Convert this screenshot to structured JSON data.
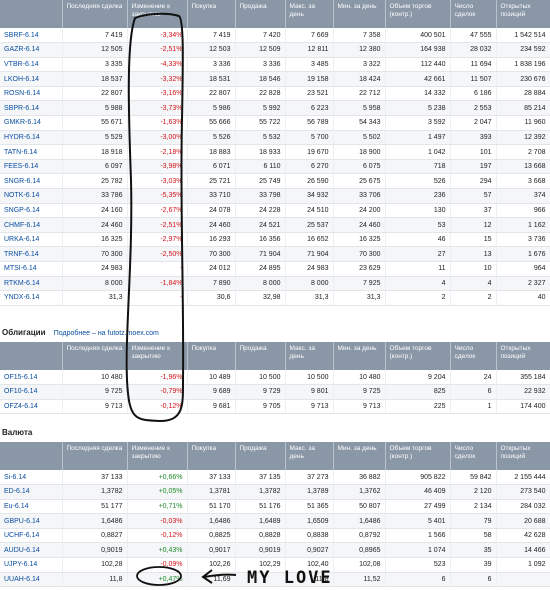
{
  "headers": {
    "futures": [
      "",
      "Последняя сделка",
      "Изменение к закрытию",
      "Покупка",
      "Продажа",
      "Макс. за день",
      "Мин. за день",
      "Объем торгов (контр.)",
      "Число сделок",
      "Открытых позиций"
    ],
    "bonds": [
      "",
      "Последняя сделка",
      "Изменение к закрытию",
      "Покупка",
      "Продажа",
      "Макс. за день",
      "Мин. за день",
      "Объем торгов (контр.)",
      "Число сделок",
      "Открытых позиций"
    ],
    "currency": [
      "",
      "Последняя сделка",
      "Изменение к закрытию",
      "Покупка",
      "Продажа",
      "Макс. за день",
      "Мин. за день",
      "Объем торгов (контр.)",
      "Число сделок",
      "Открытых позиций"
    ]
  },
  "futures": [
    [
      "SBRF-6.14",
      "7 419",
      "-3,34%",
      "7 419",
      "7 420",
      "7 669",
      "7 358",
      "400 501",
      "47 555",
      "1 542 514",
      "neg"
    ],
    [
      "GAZR-6.14",
      "12 505",
      "-2,51%",
      "12 503",
      "12 509",
      "12 811",
      "12 380",
      "164 938",
      "28 032",
      "234 592",
      "neg"
    ],
    [
      "VTBR-6.14",
      "3 335",
      "-4,33%",
      "3 336",
      "3 336",
      "3 485",
      "3 322",
      "112 440",
      "11 694",
      "1 838 196",
      "neg"
    ],
    [
      "LKOH-6.14",
      "18 537",
      "-3,32%",
      "18 531",
      "18 546",
      "19 158",
      "18 424",
      "42 661",
      "11 507",
      "230 676",
      "neg"
    ],
    [
      "ROSN-6.14",
      "22 807",
      "-3,16%",
      "22 807",
      "22 828",
      "23 521",
      "22 712",
      "14 332",
      "6 186",
      "28 884",
      "neg"
    ],
    [
      "SBPR-6.14",
      "5 988",
      "-3,73%",
      "5 986",
      "5 992",
      "6 223",
      "5 958",
      "5 238",
      "2 553",
      "85 214",
      "neg"
    ],
    [
      "GMKR-6.14",
      "55 671",
      "-1,63%",
      "55 666",
      "55 722",
      "56 789",
      "54 343",
      "3 592",
      "2 047",
      "11 960",
      "neg"
    ],
    [
      "HYDR-6.14",
      "5 529",
      "-3,00%",
      "5 526",
      "5 532",
      "5 700",
      "5 502",
      "1 497",
      "393",
      "12 392",
      "neg"
    ],
    [
      "TATN-6.14",
      "18 918",
      "-2,18%",
      "18 883",
      "18 933",
      "19 670",
      "18 900",
      "1 042",
      "101",
      "2 708",
      "neg"
    ],
    [
      "FEES-6.14",
      "6 097",
      "-3,98%",
      "6 071",
      "6 110",
      "6 270",
      "6 075",
      "718",
      "197",
      "13 668",
      "neg"
    ],
    [
      "SNGR-6.14",
      "25 782",
      "-3,03%",
      "25 721",
      "25 749",
      "26 590",
      "25 675",
      "526",
      "294",
      "3 668",
      "neg"
    ],
    [
      "NOTK-6.14",
      "33 786",
      "-5,35%",
      "33 710",
      "33 798",
      "34 932",
      "33 706",
      "236",
      "57",
      "374",
      "neg"
    ],
    [
      "SNGP-6.14",
      "24 160",
      "-2,67%",
      "24 078",
      "24 228",
      "24 510",
      "24 200",
      "130",
      "37",
      "966",
      "neg"
    ],
    [
      "CHMF-6.14",
      "24 460",
      "-2,51%",
      "24 460",
      "24 521",
      "25 537",
      "24 460",
      "53",
      "12",
      "1 162",
      "neg"
    ],
    [
      "URKA-6.14",
      "16 325",
      "-2,97%",
      "16 293",
      "16 356",
      "16 652",
      "16 325",
      "46",
      "15",
      "3 736",
      "neg"
    ],
    [
      "TRNF-6.14",
      "70 300",
      "-2,50%",
      "70 300",
      "71 904",
      "71 904",
      "70 300",
      "27",
      "13",
      "1 676",
      "neg"
    ],
    [
      "MTSI-6.14",
      "24 983",
      "-",
      "24 012",
      "24 895",
      "24 983",
      "23 629",
      "11",
      "10",
      "964",
      "neg"
    ],
    [
      "RTKM-6.14",
      "8 000",
      "-1,84%",
      "7 890",
      "8 000",
      "8 000",
      "7 925",
      "4",
      "4",
      "2 327",
      "neg"
    ],
    [
      "YNDX-6.14",
      "31,3",
      "-",
      "30,6",
      "32,98",
      "31,3",
      "31,3",
      "2",
      "2",
      "40",
      "neg"
    ]
  ],
  "bonds_title": "Облигации",
  "bonds_link": "Подробнее – на futotz.moex.com",
  "bonds": [
    [
      "OF15-6.14",
      "10 480",
      "-1,96%",
      "10 489",
      "10 500",
      "10 500",
      "10 480",
      "9 204",
      "24",
      "355 184",
      "neg"
    ],
    [
      "OF10-6.14",
      "9 725",
      "-0,79%",
      "9 689",
      "9 729",
      "9 801",
      "9 725",
      "825",
      "6",
      "22 932",
      "neg"
    ],
    [
      "OFZ4-6.14",
      "9 713",
      "-0,12%",
      "9 681",
      "9 705",
      "9 713",
      "9 713",
      "225",
      "1",
      "174 400",
      "neg"
    ]
  ],
  "currency_title": "Валюта",
  "currency": [
    [
      "Si-6.14",
      "37 133",
      "+0,66%",
      "37 133",
      "37 135",
      "37 273",
      "36 882",
      "905 822",
      "59 842",
      "2 155 444",
      "pos"
    ],
    [
      "ED-6.14",
      "1,3782",
      "+0,05%",
      "1,3781",
      "1,3782",
      "1,3789",
      "1,3762",
      "46 409",
      "2 120",
      "273 540",
      "pos"
    ],
    [
      "Eu-6.14",
      "51 177",
      "+0,71%",
      "51 170",
      "51 176",
      "51 365",
      "50 807",
      "27 499",
      "2 134",
      "284 032",
      "pos"
    ],
    [
      "GBPU-6.14",
      "1,6486",
      "-0,03%",
      "1,6486",
      "1,6489",
      "1,6509",
      "1,6486",
      "5 401",
      "79",
      "20 688",
      "neg"
    ],
    [
      "UCHF-6.14",
      "0,8827",
      "-0,12%",
      "0,8825",
      "0,8828",
      "0,8838",
      "0,8792",
      "1 566",
      "58",
      "42 628",
      "neg"
    ],
    [
      "AUDU-6.14",
      "0,9019",
      "+0,43%",
      "0,9017",
      "0,9019",
      "0,9027",
      "0,8965",
      "1 074",
      "35",
      "14 466",
      "pos"
    ],
    [
      "UJPY-6.14",
      "102,28",
      "-0,09%",
      "102,26",
      "102,29",
      "102,40",
      "102,08",
      "523",
      "39",
      "1 092",
      "neg"
    ],
    [
      "UUAH-6.14",
      "11,8",
      "+0,47%",
      "11,69",
      "",
      "11,8",
      "11,52",
      "6",
      "6",
      "",
      "pos"
    ]
  ],
  "annotation_text": "MY LOVE"
}
